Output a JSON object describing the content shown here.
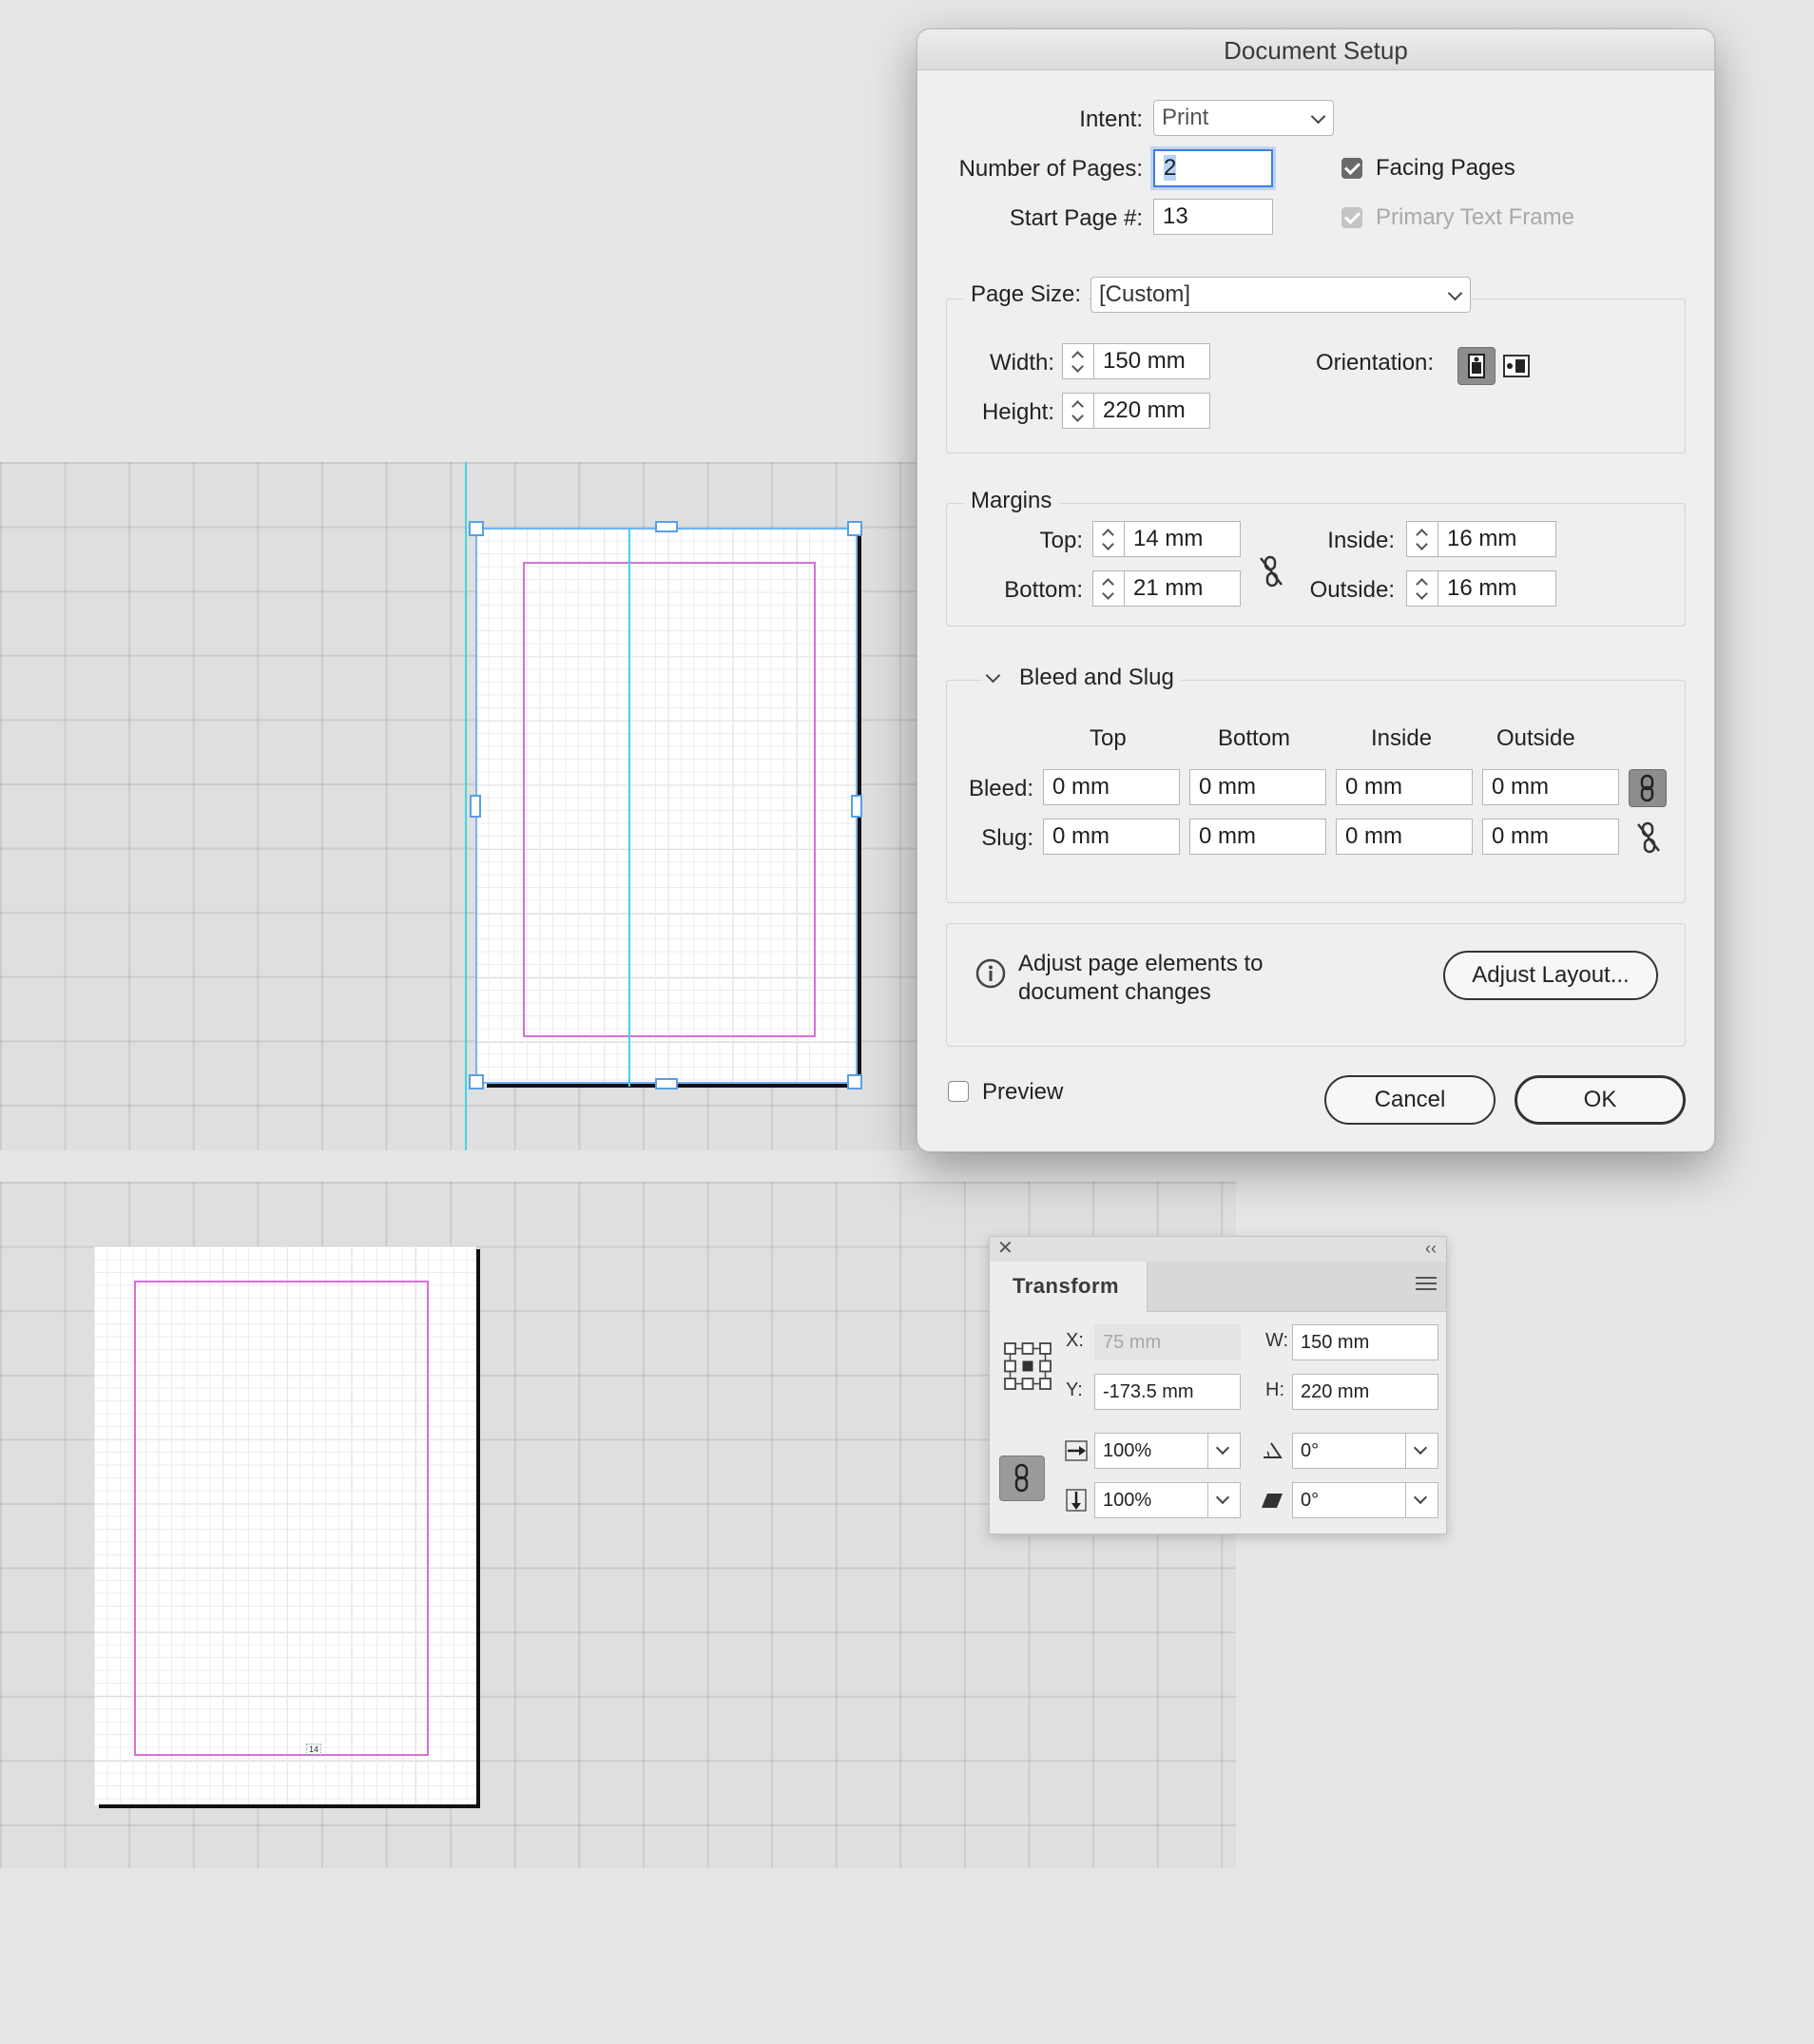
{
  "dialog": {
    "title": "Document Setup",
    "intent": {
      "label": "Intent:",
      "value": "Print"
    },
    "number_of_pages": {
      "label": "Number of Pages:",
      "value": "2"
    },
    "start_page": {
      "label": "Start Page #:",
      "value": "13"
    },
    "facing_pages": {
      "label": "Facing Pages",
      "checked": true
    },
    "primary_text_frame": {
      "label": "Primary Text Frame",
      "checked": true,
      "enabled": false
    },
    "page_size": {
      "label": "Page Size:",
      "value": "[Custom]",
      "width_label": "Width:",
      "width": "150 mm",
      "height_label": "Height:",
      "height": "220 mm",
      "orientation_label": "Orientation:",
      "orientation": "portrait"
    },
    "margins": {
      "legend": "Margins",
      "top_label": "Top:",
      "top": "14 mm",
      "bottom_label": "Bottom:",
      "bottom": "21 mm",
      "inside_label": "Inside:",
      "inside": "16 mm",
      "outside_label": "Outside:",
      "outside": "16 mm",
      "linked": false
    },
    "bleed_slug": {
      "legend": "Bleed and Slug",
      "columns": [
        "Top",
        "Bottom",
        "Inside",
        "Outside"
      ],
      "bleed_label": "Bleed:",
      "bleed": [
        "0 mm",
        "0 mm",
        "0 mm",
        "0 mm"
      ],
      "bleed_linked": true,
      "slug_label": "Slug:",
      "slug": [
        "0 mm",
        "0 mm",
        "0 mm",
        "0 mm"
      ],
      "slug_linked": false
    },
    "adjust": {
      "text": "Adjust page elements to document changes",
      "button": "Adjust Layout..."
    },
    "preview": {
      "label": "Preview",
      "checked": false
    },
    "cancel": "Cancel",
    "ok": "OK"
  },
  "transform": {
    "tab": "Transform",
    "x_label": "X:",
    "x": "75 mm",
    "y_label": "Y:",
    "y": "-173.5 mm",
    "w_label": "W:",
    "w": "150 mm",
    "h_label": "H:",
    "h": "220 mm",
    "scale_x": "100%",
    "scale_y": "100%",
    "rotation": "0°",
    "shear": "0°"
  },
  "canvas": {
    "page_number": "14"
  },
  "colors": {
    "margin_guide": "#d870d8",
    "column_guide": "#3fd5e3",
    "selection": "#6fb4ff",
    "focus": "#3b7ee8"
  }
}
